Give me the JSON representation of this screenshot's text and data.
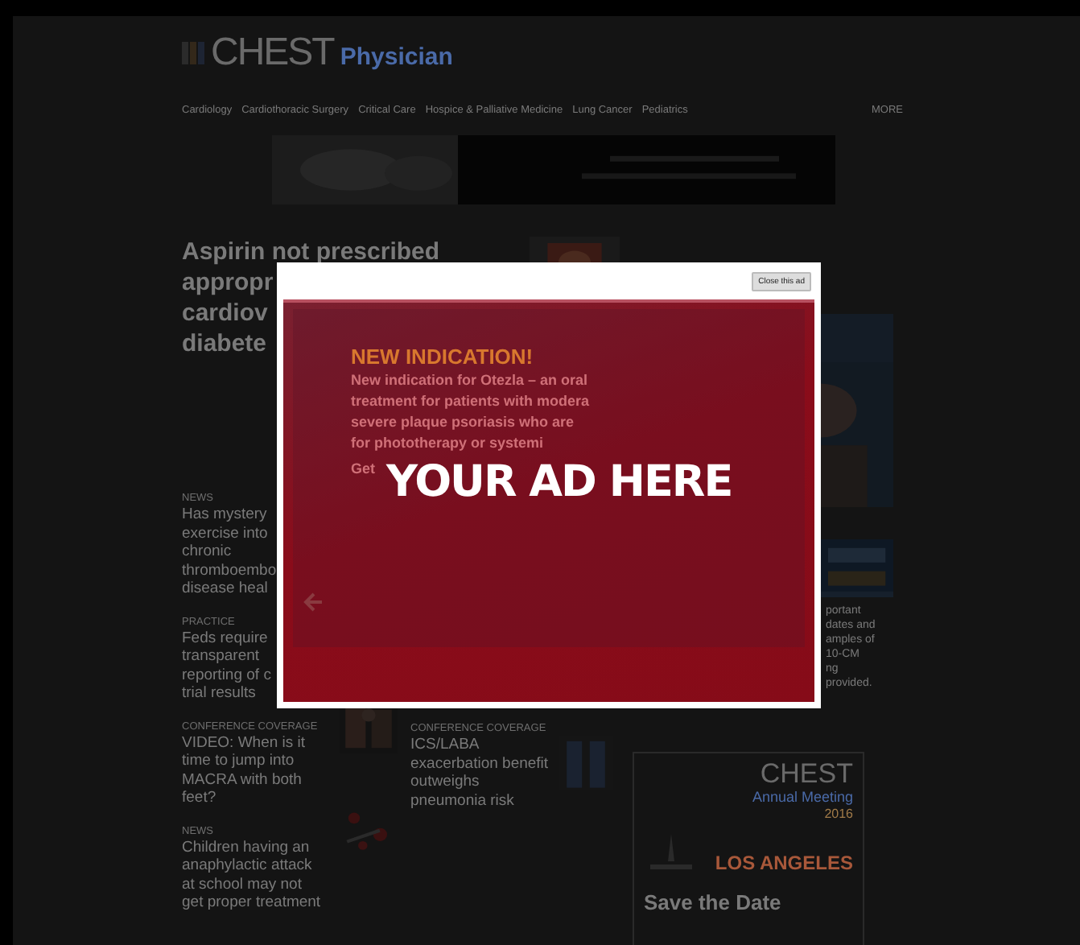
{
  "site": {
    "logo": "CHEST",
    "sublogo": "Physician",
    "nav": [
      "Cardiology",
      "Cardiothoracic Surgery",
      "Critical Care",
      "Hospice & Palliative Medicine",
      "Lung Cancer",
      "Pediatrics"
    ],
    "more": "MORE"
  },
  "lead": {
    "lines": [
      "Aspirin not prescribed",
      "appropr",
      "cardiov",
      "diabete"
    ]
  },
  "left_stories": [
    {
      "label": "NEWS",
      "lines": [
        "Has mystery",
        "exercise into",
        "chronic",
        "thromboembo",
        "disease heal"
      ]
    },
    {
      "label": "PRACTICE",
      "lines": [
        "Feds require",
        "transparent",
        "reporting of c",
        "trial results"
      ]
    },
    {
      "label": "CONFERENCE COVERAGE",
      "lines": [
        "VIDEO: When is it",
        "time to jump into",
        "MACRA with both",
        "feet?"
      ]
    },
    {
      "label": "NEWS",
      "lines": [
        "Children having an",
        "anaphylactic attack",
        "at school may not",
        "get proper treatment"
      ]
    }
  ],
  "center_story": {
    "label": "CONFERENCE COVERAGE",
    "lines": [
      "ICS/LABA",
      "exacerbation benefit",
      "outweighs",
      "pneumonia risk"
    ]
  },
  "right": {
    "notice_lines": [
      "portant",
      "dates and",
      "amples of",
      "10-CM",
      "ng",
      "provided."
    ],
    "event": {
      "logo": "CHEST",
      "subtitle": "Annual Meeting",
      "year": "2016",
      "city": "LOS ANGELES",
      "cta": "Save the Date"
    }
  },
  "modal": {
    "close_button": "Close this ad",
    "heading": "NEW INDICATION!",
    "body_lines": [
      "New indication for Otezla – an oral",
      "treatment for patients with modera",
      "severe plaque psoriasis who are",
      "for phototherapy or systemi"
    ],
    "link": "Get",
    "overlay_text": "YOUR AD HERE"
  }
}
